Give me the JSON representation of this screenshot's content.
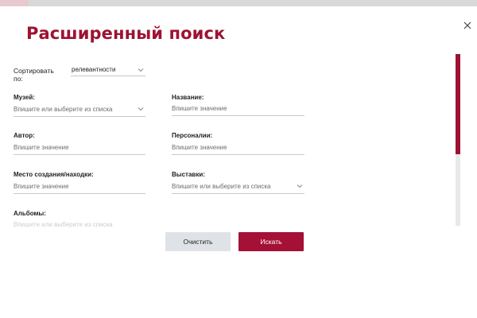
{
  "colors": {
    "accent": "#9d1233",
    "button_primary": "#a41036",
    "button_secondary": "#dfe3e7"
  },
  "modal": {
    "title": "Расширенный поиск",
    "close_icon": "close-icon"
  },
  "sort": {
    "label": "Сортировать по:",
    "value": "релевантности"
  },
  "fields": {
    "museum": {
      "label": "Музей:",
      "placeholder": "Впишите или выберите из списка"
    },
    "name": {
      "label": "Название:",
      "placeholder": "Впишите значение"
    },
    "author": {
      "label": "Автор:",
      "placeholder": "Впишите значение"
    },
    "persons": {
      "label": "Персоналии:",
      "placeholder": "Впишите значение"
    },
    "place": {
      "label": "Место создания/находки:",
      "placeholder": "Впишите значение"
    },
    "exhibitions": {
      "label": "Выставки:",
      "placeholder": "Впишите или выберите из списка"
    },
    "albums": {
      "label": "Альбомы:",
      "placeholder": "Впишите или выберите из списка"
    }
  },
  "buttons": {
    "clear": "Очистить",
    "search": "Искать"
  }
}
